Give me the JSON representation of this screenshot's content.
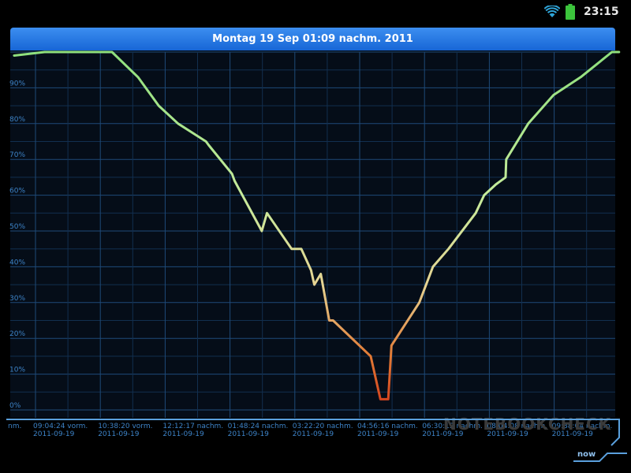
{
  "status_bar": {
    "time": "23:15",
    "wifi_icon": "wifi-icon",
    "battery_icon": "battery-icon"
  },
  "header": {
    "title": "Montag 19 Sep 01:09 nachm. 2011"
  },
  "watermark": "NOTEBOOKCHECK",
  "now_label": "now",
  "colors": {
    "title_bar": "#1f74e0",
    "grid": "#1e4a78",
    "axis_text": "#3d83c7",
    "line_high": "#8fe07d",
    "line_low": "#d23a1a",
    "background": "#000000"
  },
  "chart_data": {
    "type": "line",
    "title": "",
    "xlabel": "",
    "ylabel": "",
    "ylim": [
      0,
      100
    ],
    "grid": true,
    "y_ticks": [
      "0%",
      "10%",
      "20%",
      "30%",
      "40%",
      "50%",
      "60%",
      "70%",
      "80%",
      "90%"
    ],
    "x_ticks": [
      {
        "time": "09:04:24 vorm.",
        "date": "2011-09-19"
      },
      {
        "time": "10:38:20 vorm.",
        "date": "2011-09-19"
      },
      {
        "time": "12:12:17 nachm.",
        "date": "2011-09-19"
      },
      {
        "time": "01:48:24 nachm.",
        "date": "2011-09-19"
      },
      {
        "time": "03:22:20 nachm.",
        "date": "2011-09-19"
      },
      {
        "time": "04:56:16 nachm.",
        "date": "2011-09-19"
      },
      {
        "time": "06:30:12 nachm.",
        "date": "2011-09-19"
      },
      {
        "time": "08:04:08 nachm.",
        "date": "2011-09-19"
      },
      {
        "time": "09:38:04 nachm.",
        "date": "2011-09-19"
      }
    ],
    "x_label_fragment": "nm.",
    "series": [
      {
        "values": [
          [
            -0.33,
            99
          ],
          [
            0.14,
            100
          ],
          [
            1.18,
            100
          ],
          [
            1.58,
            93
          ],
          [
            1.9,
            85
          ],
          [
            2.2,
            80
          ],
          [
            2.63,
            75
          ],
          [
            2.67,
            74
          ],
          [
            3.03,
            66
          ],
          [
            3.07,
            64
          ],
          [
            3.49,
            50
          ],
          [
            3.57,
            55
          ],
          [
            3.95,
            45
          ],
          [
            4.1,
            45
          ],
          [
            4.25,
            39
          ],
          [
            4.3,
            35
          ],
          [
            4.4,
            38
          ],
          [
            4.53,
            25
          ],
          [
            4.59,
            25
          ],
          [
            5.17,
            15
          ],
          [
            5.32,
            3
          ],
          [
            5.44,
            3
          ],
          [
            5.49,
            18
          ],
          [
            5.92,
            30
          ],
          [
            6.13,
            40
          ],
          [
            6.37,
            45
          ],
          [
            6.79,
            55
          ],
          [
            6.92,
            60
          ],
          [
            7.1,
            63
          ],
          [
            7.25,
            65
          ],
          [
            7.26,
            70
          ],
          [
            7.6,
            80
          ],
          [
            7.99,
            88
          ],
          [
            8.41,
            93
          ],
          [
            8.89,
            100
          ],
          [
            9.0,
            100
          ]
        ]
      }
    ]
  }
}
